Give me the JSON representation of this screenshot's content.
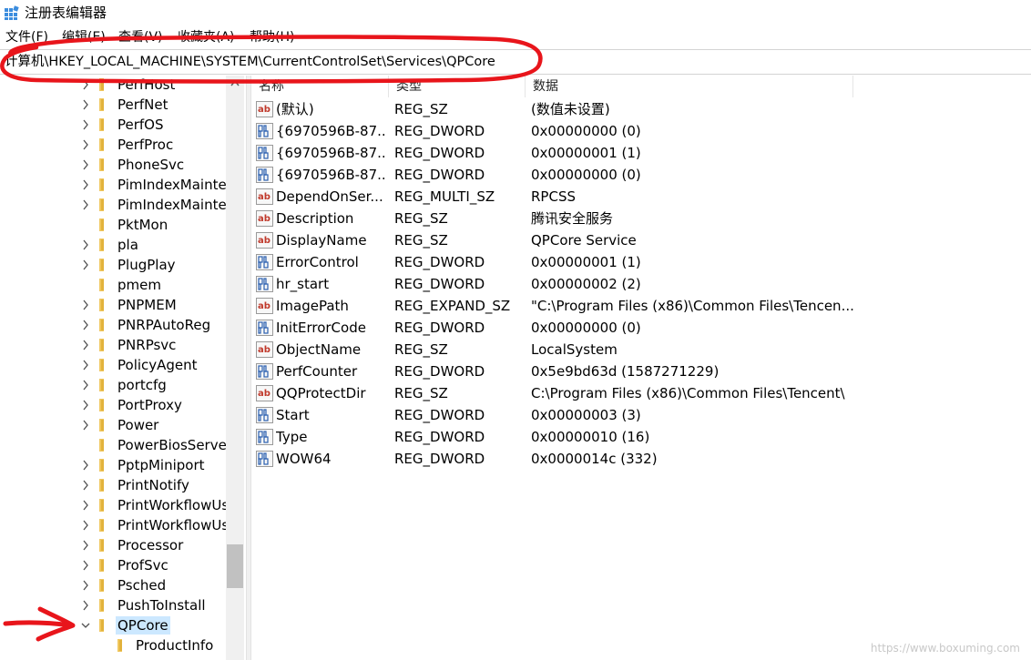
{
  "window": {
    "title": "注册表编辑器"
  },
  "menu": [
    "文件(F)",
    "编辑(E)",
    "查看(V)",
    "收藏夹(A)",
    "帮助(H)"
  ],
  "address": {
    "path": "计算机\\HKEY_LOCAL_MACHINE\\SYSTEM\\CurrentControlSet\\Services\\QPCore"
  },
  "tree": {
    "items": [
      {
        "label": "PerfHost",
        "expandable": true
      },
      {
        "label": "PerfNet",
        "expandable": true
      },
      {
        "label": "PerfOS",
        "expandable": true
      },
      {
        "label": "PerfProc",
        "expandable": true
      },
      {
        "label": "PhoneSvc",
        "expandable": true
      },
      {
        "label": "PimIndexMainte",
        "expandable": true
      },
      {
        "label": "PimIndexMainte",
        "expandable": true
      },
      {
        "label": "PktMon",
        "expandable": false
      },
      {
        "label": "pla",
        "expandable": true
      },
      {
        "label": "PlugPlay",
        "expandable": true
      },
      {
        "label": "pmem",
        "expandable": false
      },
      {
        "label": "PNPMEM",
        "expandable": true
      },
      {
        "label": "PNRPAutoReg",
        "expandable": true
      },
      {
        "label": "PNRPsvc",
        "expandable": true
      },
      {
        "label": "PolicyAgent",
        "expandable": true
      },
      {
        "label": "portcfg",
        "expandable": true
      },
      {
        "label": "PortProxy",
        "expandable": true
      },
      {
        "label": "Power",
        "expandable": true
      },
      {
        "label": "PowerBiosServe",
        "expandable": false
      },
      {
        "label": "PptpMiniport",
        "expandable": true
      },
      {
        "label": "PrintNotify",
        "expandable": true
      },
      {
        "label": "PrintWorkflowUs",
        "expandable": true
      },
      {
        "label": "PrintWorkflowUs",
        "expandable": true
      },
      {
        "label": "Processor",
        "expandable": true
      },
      {
        "label": "ProfSvc",
        "expandable": true
      },
      {
        "label": "Psched",
        "expandable": true
      },
      {
        "label": "PushToInstall",
        "expandable": true
      },
      {
        "label": "QPCore",
        "expandable": true,
        "expanded": true,
        "selected": true
      },
      {
        "label": "ProductInfo",
        "expandable": false,
        "child": true
      }
    ]
  },
  "list": {
    "columns": [
      "名称",
      "类型",
      "数据"
    ],
    "rows": [
      {
        "icon": "string-value-icon",
        "name": "(默认)",
        "type": "REG_SZ",
        "data": "(数值未设置)"
      },
      {
        "icon": "binary-value-icon",
        "name": "{6970596B-87...",
        "type": "REG_DWORD",
        "data": "0x00000000 (0)"
      },
      {
        "icon": "binary-value-icon",
        "name": "{6970596B-87...",
        "type": "REG_DWORD",
        "data": "0x00000001 (1)"
      },
      {
        "icon": "binary-value-icon",
        "name": "{6970596B-87...",
        "type": "REG_DWORD",
        "data": "0x00000000 (0)"
      },
      {
        "icon": "string-value-icon",
        "name": "DependOnSer...",
        "type": "REG_MULTI_SZ",
        "data": "RPCSS"
      },
      {
        "icon": "string-value-icon",
        "name": "Description",
        "type": "REG_SZ",
        "data": "腾讯安全服务"
      },
      {
        "icon": "string-value-icon",
        "name": "DisplayName",
        "type": "REG_SZ",
        "data": "QPCore Service"
      },
      {
        "icon": "binary-value-icon",
        "name": "ErrorControl",
        "type": "REG_DWORD",
        "data": "0x00000001 (1)"
      },
      {
        "icon": "binary-value-icon",
        "name": "hr_start",
        "type": "REG_DWORD",
        "data": "0x00000002 (2)"
      },
      {
        "icon": "string-value-icon",
        "name": "ImagePath",
        "type": "REG_EXPAND_SZ",
        "data": "\"C:\\Program Files (x86)\\Common Files\\Tencen..."
      },
      {
        "icon": "binary-value-icon",
        "name": "InitErrorCode",
        "type": "REG_DWORD",
        "data": "0x00000000 (0)"
      },
      {
        "icon": "string-value-icon",
        "name": "ObjectName",
        "type": "REG_SZ",
        "data": "LocalSystem"
      },
      {
        "icon": "binary-value-icon",
        "name": "PerfCounter",
        "type": "REG_DWORD",
        "data": "0x5e9bd63d (1587271229)"
      },
      {
        "icon": "string-value-icon",
        "name": "QQProtectDir",
        "type": "REG_SZ",
        "data": "C:\\Program Files (x86)\\Common Files\\Tencent\\"
      },
      {
        "icon": "binary-value-icon",
        "name": "Start",
        "type": "REG_DWORD",
        "data": "0x00000003 (3)"
      },
      {
        "icon": "binary-value-icon",
        "name": "Type",
        "type": "REG_DWORD",
        "data": "0x00000010 (16)"
      },
      {
        "icon": "binary-value-icon",
        "name": "WOW64",
        "type": "REG_DWORD",
        "data": "0x0000014c (332)"
      }
    ]
  },
  "watermark": "https://www.boxuming.com",
  "colors": {
    "annotation": "#e8151b",
    "selection": "#cce8ff",
    "folder": "#f0c75e"
  }
}
